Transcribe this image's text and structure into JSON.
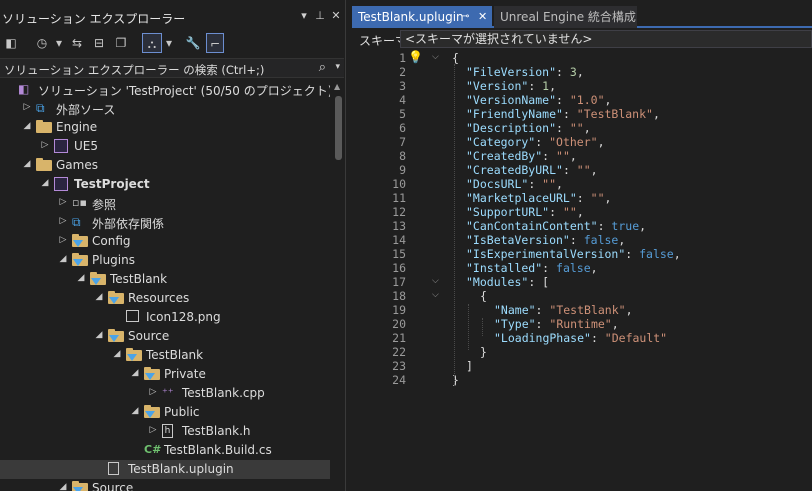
{
  "explorer": {
    "title": "ソリューション エクスプローラー",
    "title_buttons": [
      "▾",
      "⊥",
      "✕"
    ],
    "toolbar": [
      {
        "name": "vs-icon",
        "glyph": "◧"
      },
      {
        "name": "history-icon",
        "glyph": "◷"
      },
      {
        "name": "dropdown-icon",
        "glyph": "▾"
      },
      {
        "name": "sync-icon",
        "glyph": "⇆"
      },
      {
        "name": "collapse-icon",
        "glyph": "⊟"
      },
      {
        "name": "copy-icon",
        "glyph": "❐"
      },
      {
        "name": "filter-icon",
        "glyph": "⛬"
      },
      {
        "name": "dropdown-icon",
        "glyph": "▾"
      },
      {
        "name": "wrench-icon",
        "glyph": "🔧"
      },
      {
        "name": "preview-icon",
        "glyph": "⌐"
      }
    ],
    "search_placeholder": "ソリューション エクスプローラー の検索 (Ctrl+;)",
    "tree": [
      {
        "label": "ソリューション 'TestProject' (50/50 のプロジェクト)",
        "level": 0,
        "arrow": "",
        "icon": "solution",
        "bold": false
      },
      {
        "label": "外部ソース",
        "level": 1,
        "arrow": "▷",
        "icon": "ext",
        "bold": false
      },
      {
        "label": "Engine",
        "level": 1,
        "arrow": "◢",
        "icon": "folder",
        "bold": false
      },
      {
        "label": "UE5",
        "level": 2,
        "arrow": "▷",
        "icon": "box",
        "bold": false
      },
      {
        "label": "Games",
        "level": 1,
        "arrow": "◢",
        "icon": "folder",
        "bold": false
      },
      {
        "label": "TestProject",
        "level": 2,
        "arrow": "◢",
        "icon": "box",
        "bold": true
      },
      {
        "label": "参照",
        "level": 3,
        "arrow": "▷",
        "icon": "ref",
        "bold": false
      },
      {
        "label": "外部依存関係",
        "level": 3,
        "arrow": "▷",
        "icon": "ext",
        "bold": false
      },
      {
        "label": "Config",
        "level": 3,
        "arrow": "▷",
        "icon": "ffolder",
        "bold": false
      },
      {
        "label": "Plugins",
        "level": 3,
        "arrow": "◢",
        "icon": "ffolder",
        "bold": false
      },
      {
        "label": "TestBlank",
        "level": 4,
        "arrow": "◢",
        "icon": "ffolder",
        "bold": false
      },
      {
        "label": "Resources",
        "level": 5,
        "arrow": "◢",
        "icon": "ffolder",
        "bold": false
      },
      {
        "label": "Icon128.png",
        "level": 6,
        "arrow": "",
        "icon": "img",
        "bold": false
      },
      {
        "label": "Source",
        "level": 5,
        "arrow": "◢",
        "icon": "ffolder",
        "bold": false
      },
      {
        "label": "TestBlank",
        "level": 6,
        "arrow": "◢",
        "icon": "ffolder",
        "bold": false
      },
      {
        "label": "Private",
        "level": 7,
        "arrow": "◢",
        "icon": "ffolder",
        "bold": false
      },
      {
        "label": "TestBlank.cpp",
        "level": 8,
        "arrow": "▷",
        "icon": "cpp",
        "bold": false
      },
      {
        "label": "Public",
        "level": 7,
        "arrow": "◢",
        "icon": "ffolder",
        "bold": false
      },
      {
        "label": "TestBlank.h",
        "level": 8,
        "arrow": "▷",
        "icon": "h",
        "bold": false
      },
      {
        "label": "TestBlank.Build.cs",
        "level": 7,
        "arrow": "",
        "icon": "cs",
        "bold": false
      },
      {
        "label": "TestBlank.uplugin",
        "level": 5,
        "arrow": "",
        "icon": "file",
        "bold": false,
        "selected": true
      },
      {
        "label": "Source",
        "level": 3,
        "arrow": "◢",
        "icon": "ffolder",
        "bold": false
      }
    ]
  },
  "editor": {
    "tabs": [
      {
        "label": "TestBlank.uplugin",
        "pin": "⊸",
        "close": "✕",
        "active": true
      },
      {
        "label": "Unreal Engine 統合構成",
        "active": false
      }
    ],
    "schema_label": "スキーマ:",
    "schema_value": "<スキーマが選択されていません>",
    "lines": [
      {
        "n": "1",
        "indent": 0,
        "tokens": [
          [
            "pun",
            "{"
          ]
        ]
      },
      {
        "n": "2",
        "indent": 1,
        "tokens": [
          [
            "key",
            "\"FileVersion\""
          ],
          [
            "pun",
            ": "
          ],
          [
            "num",
            "3"
          ],
          [
            "pun",
            ","
          ]
        ]
      },
      {
        "n": "3",
        "indent": 1,
        "tokens": [
          [
            "key",
            "\"Version\""
          ],
          [
            "pun",
            ": "
          ],
          [
            "num",
            "1"
          ],
          [
            "pun",
            ","
          ]
        ]
      },
      {
        "n": "4",
        "indent": 1,
        "tokens": [
          [
            "key",
            "\"VersionName\""
          ],
          [
            "pun",
            ": "
          ],
          [
            "str",
            "\"1.0\""
          ],
          [
            "pun",
            ","
          ]
        ]
      },
      {
        "n": "5",
        "indent": 1,
        "tokens": [
          [
            "key",
            "\"FriendlyName\""
          ],
          [
            "pun",
            ": "
          ],
          [
            "str",
            "\"TestBlank\""
          ],
          [
            "pun",
            ","
          ]
        ]
      },
      {
        "n": "6",
        "indent": 1,
        "tokens": [
          [
            "key",
            "\"Description\""
          ],
          [
            "pun",
            ": "
          ],
          [
            "str",
            "\"\""
          ],
          [
            "pun",
            ","
          ]
        ]
      },
      {
        "n": "7",
        "indent": 1,
        "tokens": [
          [
            "key",
            "\"Category\""
          ],
          [
            "pun",
            ": "
          ],
          [
            "str",
            "\"Other\""
          ],
          [
            "pun",
            ","
          ]
        ]
      },
      {
        "n": "8",
        "indent": 1,
        "tokens": [
          [
            "key",
            "\"CreatedBy\""
          ],
          [
            "pun",
            ": "
          ],
          [
            "str",
            "\"\""
          ],
          [
            "pun",
            ","
          ]
        ]
      },
      {
        "n": "9",
        "indent": 1,
        "tokens": [
          [
            "key",
            "\"CreatedByURL\""
          ],
          [
            "pun",
            ": "
          ],
          [
            "str",
            "\"\""
          ],
          [
            "pun",
            ","
          ]
        ]
      },
      {
        "n": "10",
        "indent": 1,
        "tokens": [
          [
            "key",
            "\"DocsURL\""
          ],
          [
            "pun",
            ": "
          ],
          [
            "str",
            "\"\""
          ],
          [
            "pun",
            ","
          ]
        ]
      },
      {
        "n": "11",
        "indent": 1,
        "tokens": [
          [
            "key",
            "\"MarketplaceURL\""
          ],
          [
            "pun",
            ": "
          ],
          [
            "str",
            "\"\""
          ],
          [
            "pun",
            ","
          ]
        ]
      },
      {
        "n": "12",
        "indent": 1,
        "tokens": [
          [
            "key",
            "\"SupportURL\""
          ],
          [
            "pun",
            ": "
          ],
          [
            "str",
            "\"\""
          ],
          [
            "pun",
            ","
          ]
        ]
      },
      {
        "n": "13",
        "indent": 1,
        "tokens": [
          [
            "key",
            "\"CanContainContent\""
          ],
          [
            "pun",
            ": "
          ],
          [
            "kw",
            "true"
          ],
          [
            "pun",
            ","
          ]
        ]
      },
      {
        "n": "14",
        "indent": 1,
        "tokens": [
          [
            "key",
            "\"IsBetaVersion\""
          ],
          [
            "pun",
            ": "
          ],
          [
            "kw",
            "false"
          ],
          [
            "pun",
            ","
          ]
        ]
      },
      {
        "n": "15",
        "indent": 1,
        "tokens": [
          [
            "key",
            "\"IsExperimentalVersion\""
          ],
          [
            "pun",
            ": "
          ],
          [
            "kw",
            "false"
          ],
          [
            "pun",
            ","
          ]
        ]
      },
      {
        "n": "16",
        "indent": 1,
        "tokens": [
          [
            "key",
            "\"Installed\""
          ],
          [
            "pun",
            ": "
          ],
          [
            "kw",
            "false"
          ],
          [
            "pun",
            ","
          ]
        ]
      },
      {
        "n": "17",
        "indent": 1,
        "tokens": [
          [
            "key",
            "\"Modules\""
          ],
          [
            "pun",
            ": ["
          ]
        ]
      },
      {
        "n": "18",
        "indent": 2,
        "tokens": [
          [
            "pun",
            "{"
          ]
        ]
      },
      {
        "n": "19",
        "indent": 3,
        "tokens": [
          [
            "key",
            "\"Name\""
          ],
          [
            "pun",
            ": "
          ],
          [
            "str",
            "\"TestBlank\""
          ],
          [
            "pun",
            ","
          ]
        ]
      },
      {
        "n": "20",
        "indent": 3,
        "tokens": [
          [
            "key",
            "\"Type\""
          ],
          [
            "pun",
            ": "
          ],
          [
            "str",
            "\"Runtime\""
          ],
          [
            "pun",
            ","
          ]
        ]
      },
      {
        "n": "21",
        "indent": 3,
        "tokens": [
          [
            "key",
            "\"LoadingPhase\""
          ],
          [
            "pun",
            ": "
          ],
          [
            "str",
            "\"Default\""
          ]
        ]
      },
      {
        "n": "22",
        "indent": 2,
        "tokens": [
          [
            "pun",
            "}"
          ]
        ]
      },
      {
        "n": "23",
        "indent": 1,
        "tokens": [
          [
            "pun",
            "]"
          ]
        ]
      },
      {
        "n": "24",
        "indent": 0,
        "tokens": [
          [
            "pun",
            "}"
          ]
        ]
      }
    ],
    "fold_markers": {
      "1": "⌵",
      "17": "⌵",
      "18": "⌵"
    }
  },
  "colors": {
    "accent": "#3d6ab0",
    "folder": "#d8b46a",
    "filter": "#4aa3e8",
    "key": "#9cdcfe",
    "string": "#ce9178",
    "keyword": "#569cd6"
  }
}
